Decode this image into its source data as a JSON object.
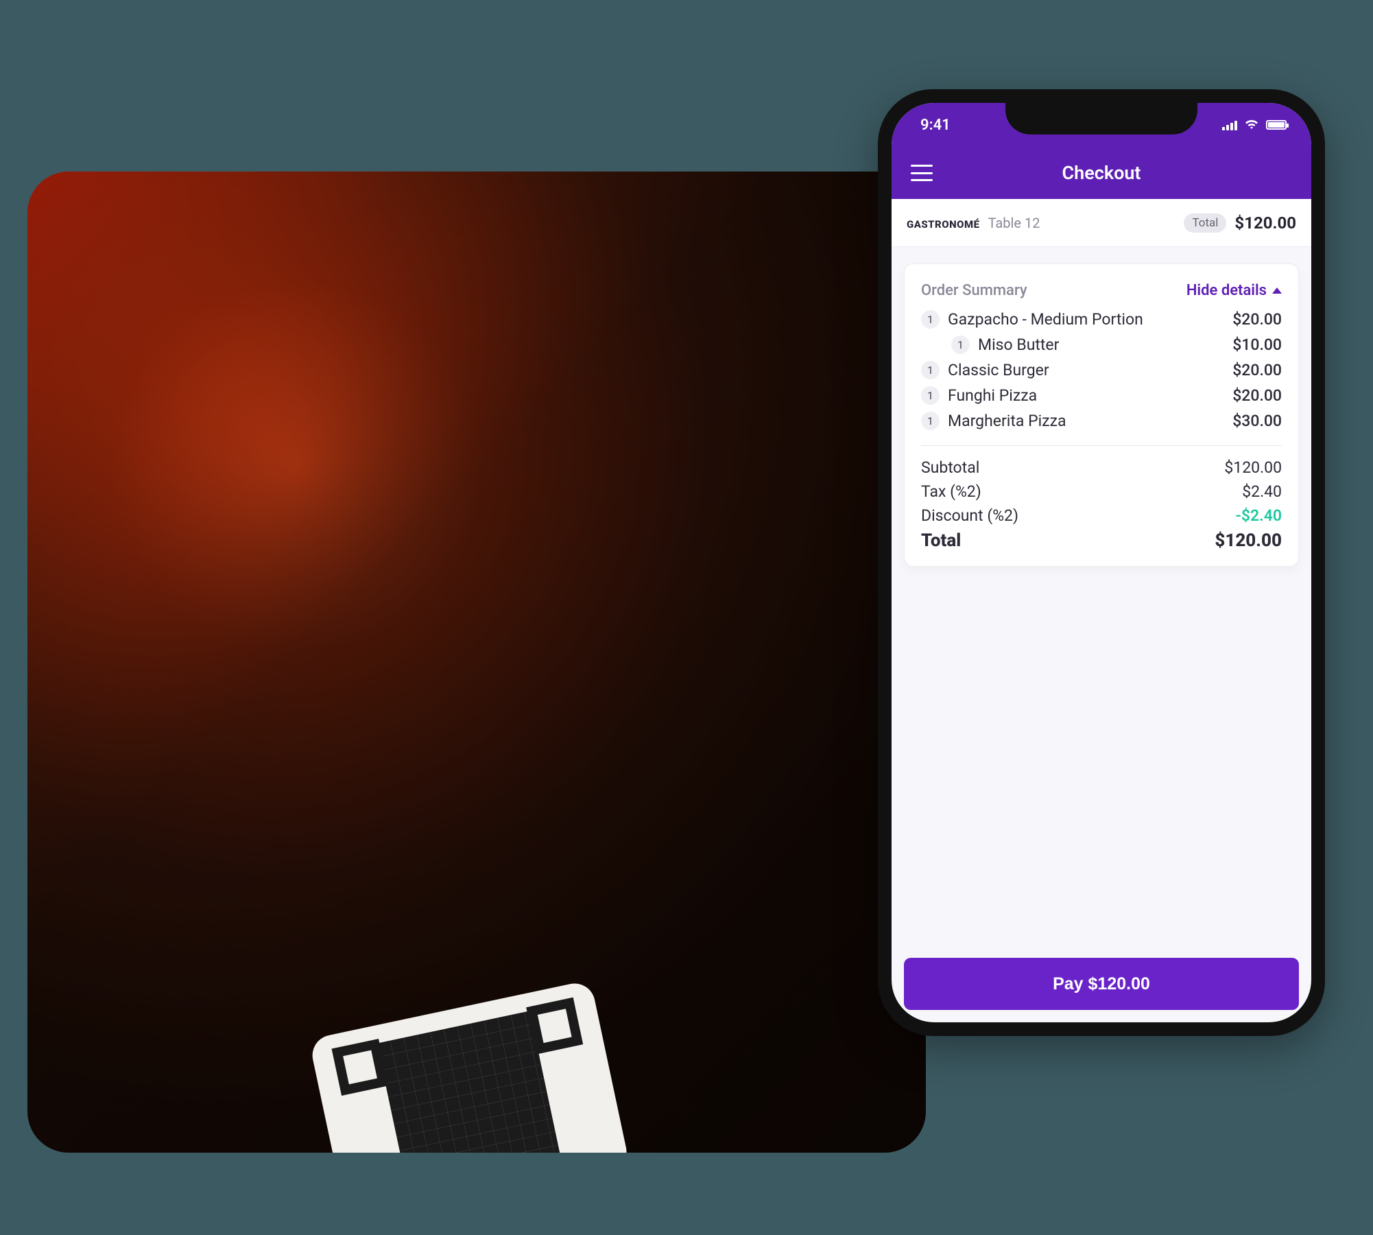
{
  "status": {
    "time": "9:41"
  },
  "header": {
    "title": "Checkout"
  },
  "sub": {
    "brand": "GASTRONOMÉ",
    "table": "Table 12",
    "totalLabel": "Total",
    "totalAmount": "$120.00"
  },
  "order": {
    "title": "Order Summary",
    "toggle": "Hide details",
    "items": [
      {
        "qty": "1",
        "name": "Gazpacho - Medium Portion",
        "price": "$20.00",
        "nested": false
      },
      {
        "qty": "1",
        "name": "Miso Butter",
        "price": "$10.00",
        "nested": true
      },
      {
        "qty": "1",
        "name": "Classic Burger",
        "price": "$20.00",
        "nested": false
      },
      {
        "qty": "1",
        "name": "Funghi Pizza",
        "price": "$20.00",
        "nested": false
      },
      {
        "qty": "1",
        "name": "Margherita Pizza",
        "price": "$30.00",
        "nested": false
      }
    ],
    "subtotal": {
      "label": "Subtotal",
      "value": "$120.00"
    },
    "tax": {
      "label": "Tax (%2)",
      "value": "$2.40"
    },
    "discount": {
      "label": "Discount (%2)",
      "value": "-$2.40"
    },
    "total": {
      "label": "Total",
      "value": "$120.00"
    }
  },
  "pay": {
    "label": "Pay $120.00"
  }
}
